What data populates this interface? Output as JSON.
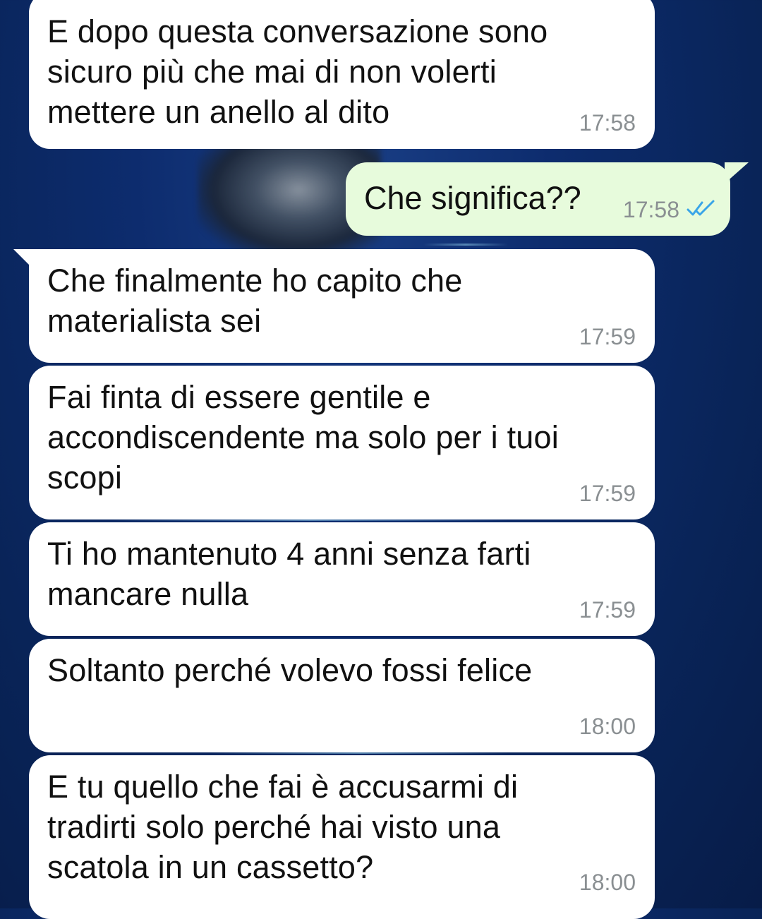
{
  "theme": {
    "incoming_bubble": "#ffffff",
    "outgoing_bubble": "#e7fbdc",
    "timestamp_color": "#8a8f92",
    "read_ticks_color": "#3aa5e8",
    "wallpaper": "#0d2c6e"
  },
  "messages": [
    {
      "direction": "incoming",
      "text": "E dopo questa conversazione sono\nsicuro più che mai di non volerti\nmettere un anello al dito",
      "time": "17:58"
    },
    {
      "direction": "outgoing",
      "text": "Che significa??",
      "time": "17:58",
      "status_icon": "double-check-read-icon"
    },
    {
      "direction": "incoming",
      "text": "Che finalmente ho capito che\nmaterialista sei",
      "time": "17:59"
    },
    {
      "direction": "incoming",
      "text": "Fai finta di essere gentile e\naccondiscendente ma solo per i tuoi\nscopi",
      "time": "17:59"
    },
    {
      "direction": "incoming",
      "text": "Ti ho mantenuto 4 anni senza farti\nmancare nulla",
      "time": "17:59"
    },
    {
      "direction": "incoming",
      "text": "Soltanto perché volevo fossi felice",
      "time": "18:00"
    },
    {
      "direction": "incoming",
      "text": "E tu quello che fai è accusarmi di\ntradirti solo perché hai visto una\nscatola in un cassetto?",
      "time": "18:00"
    }
  ]
}
